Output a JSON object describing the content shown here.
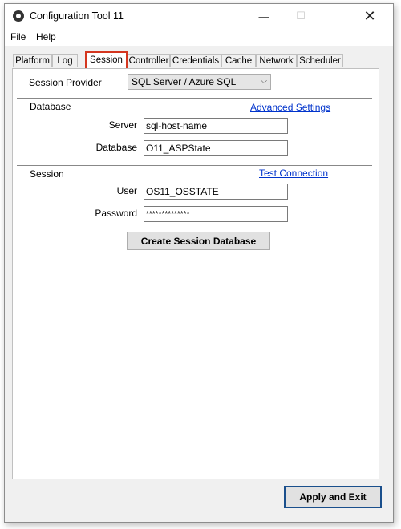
{
  "window": {
    "title": "Configuration Tool 11"
  },
  "window_controls": {
    "minimize": "—",
    "maximize": "☐",
    "close": "✕"
  },
  "menu": {
    "file": "File",
    "help": "Help"
  },
  "tabs": [
    "Platform",
    "Log",
    "Session",
    "Controller",
    "Credentials",
    "Cache",
    "Network",
    "Scheduler"
  ],
  "active_tab": "Session",
  "session_provider": {
    "label": "Session Provider",
    "value": "SQL Server / Azure SQL"
  },
  "database_section": {
    "title": "Database",
    "advanced_link": "Advanced Settings",
    "server_label": "Server",
    "server_value": "sql-host-name",
    "database_label": "Database",
    "database_value": "O11_ASPState"
  },
  "session_section": {
    "title": "Session",
    "test_link": "Test Connection",
    "user_label": "User",
    "user_value": "OS11_OSSTATE",
    "password_label": "Password",
    "password_value": "**************"
  },
  "create_button": "Create Session Database",
  "apply_button": "Apply and Exit"
}
